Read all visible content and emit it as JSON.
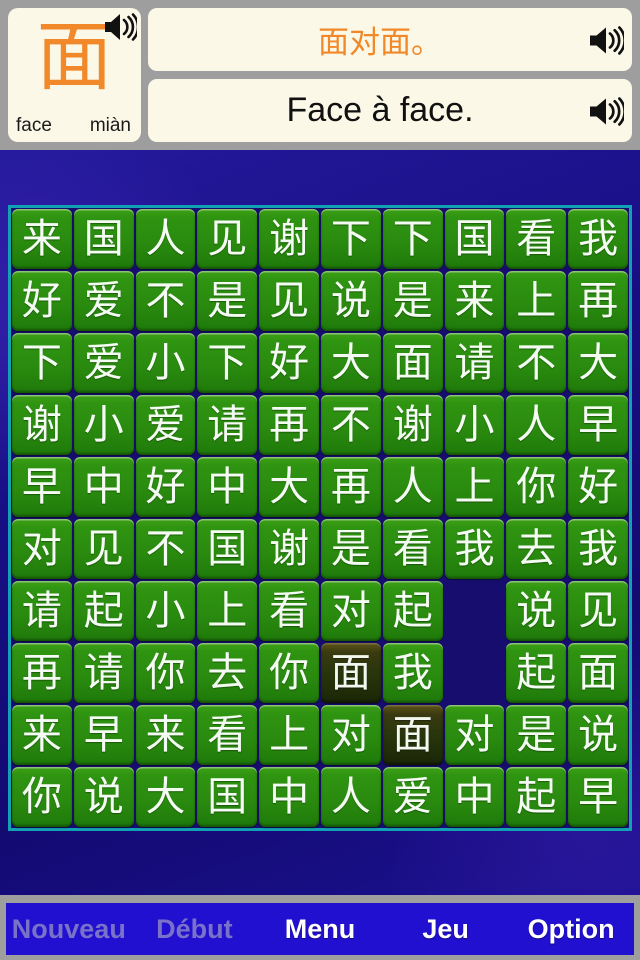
{
  "header": {
    "card": {
      "hanzi": "面",
      "meaning": "face",
      "pinyin": "miàn",
      "speaker_icon": "speaker-icon"
    },
    "sentence_chinese": {
      "text": "面对面。",
      "speaker_icon": "speaker-icon"
    },
    "sentence_french": {
      "text": "Face à face.",
      "speaker_icon": "speaker-icon"
    }
  },
  "board": {
    "rows": 10,
    "cols": 10,
    "tiles": [
      [
        "来",
        "国",
        "人",
        "见",
        "谢",
        "下",
        "下",
        "国",
        "看",
        "我"
      ],
      [
        "好",
        "爱",
        "不",
        "是",
        "见",
        "说",
        "是",
        "来",
        "上",
        "再"
      ],
      [
        "下",
        "爱",
        "小",
        "下",
        "好",
        "大",
        "面",
        "请",
        "不",
        "大"
      ],
      [
        "谢",
        "小",
        "爱",
        "请",
        "再",
        "不",
        "谢",
        "小",
        "人",
        "早"
      ],
      [
        "早",
        "中",
        "好",
        "中",
        "大",
        "再",
        "人",
        "上",
        "你",
        "好"
      ],
      [
        "对",
        "见",
        "不",
        "国",
        "谢",
        "是",
        "看",
        "我",
        "去",
        "我"
      ],
      [
        "请",
        "起",
        "小",
        "上",
        "看",
        "对",
        "起",
        "",
        "说",
        "见"
      ],
      [
        "再",
        "请",
        "你",
        "去",
        "你",
        "面",
        "我",
        "",
        "起",
        "面"
      ],
      [
        "来",
        "早",
        "来",
        "看",
        "上",
        "对",
        "面",
        "对",
        "是",
        "说"
      ],
      [
        "你",
        "说",
        "大",
        "国",
        "中",
        "人",
        "爱",
        "中",
        "起",
        "早"
      ]
    ],
    "selected": [
      [
        7,
        5
      ],
      [
        8,
        6
      ]
    ],
    "empty": [
      [
        6,
        7
      ],
      [
        7,
        7
      ]
    ]
  },
  "toolbar": {
    "buttons": [
      {
        "label": "Nouveau",
        "enabled": false
      },
      {
        "label": "Début",
        "enabled": false
      },
      {
        "label": "Menu",
        "enabled": true
      },
      {
        "label": "Jeu",
        "enabled": true
      },
      {
        "label": "Option",
        "enabled": true
      }
    ]
  },
  "colors": {
    "tile_green": "#2f9411",
    "tile_selected": "#26350b",
    "board_border": "#12a0b4",
    "board_bg": "#170d6e",
    "accent_orange": "#f1892a",
    "card_bg": "#fbf8e8",
    "toolbar_blue": "#2110cf",
    "chrome_gray": "#9e9e9e",
    "disabled_text": "#7a72c9"
  }
}
